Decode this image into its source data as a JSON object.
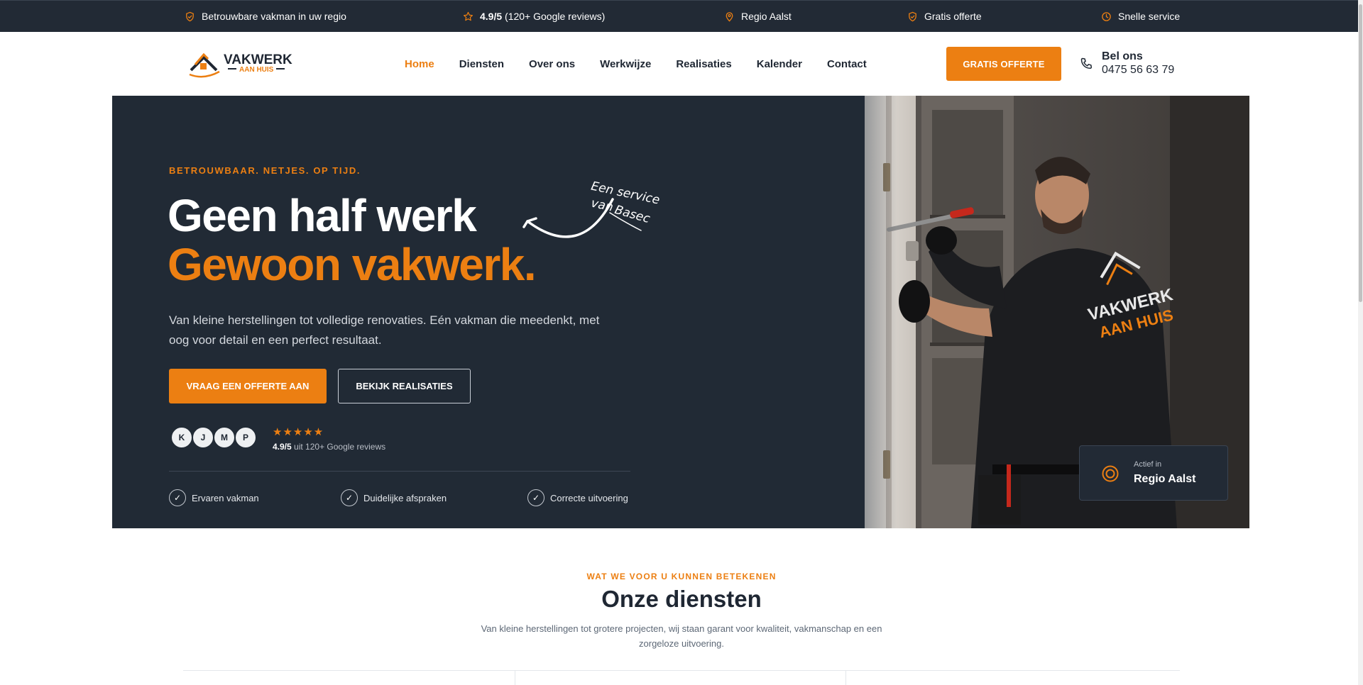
{
  "topbar": {
    "items": [
      {
        "icon": "shield-check-icon",
        "text": "Betrouwbare vakman in uw regio"
      },
      {
        "icon": "star-icon",
        "rating": "4.9/5",
        "text": "(120+ Google reviews)"
      },
      {
        "icon": "map-pin-icon",
        "text": "Regio Aalst"
      },
      {
        "icon": "shield-check-icon",
        "text": "Gratis offerte"
      },
      {
        "icon": "clock-icon",
        "text": "Snelle service"
      }
    ]
  },
  "header": {
    "logo": {
      "line1": "VAKWERK",
      "line2": "AAN HUIS"
    },
    "nav": [
      "Home",
      "Diensten",
      "Over ons",
      "Werkwijze",
      "Realisaties",
      "Kalender",
      "Contact"
    ],
    "active_nav": "Home",
    "cta": "GRATIS OFFERTE",
    "call_label": "Bel ons",
    "phone": "0475 56 63 79"
  },
  "hero": {
    "eyebrow": "BETROUWBAAR. NETJES. OP TIJD.",
    "title_line1": "Geen half werk",
    "title_line2": "Gewoon vakwerk.",
    "handwritten_line1": "Een service",
    "handwritten_line2": "van",
    "handwritten_brand": "Basec",
    "description": "Van kleine herstellingen tot volledige renovaties. Eén vakman die meedenkt, met oog voor detail en een perfect resultaat.",
    "primary_button": "VRAAG EEN OFFERTE AAN",
    "secondary_button": "BEKIJK REALISATIES",
    "avatars": [
      "K",
      "J",
      "M",
      "P"
    ],
    "stars": "★★★★★",
    "rating_value": "4.9/5",
    "rating_text": "uit 120+ Google reviews",
    "features": [
      "Ervaren vakman",
      "Duidelijke afspraken",
      "Correcte uitvoering"
    ],
    "badge_small": "Actief in",
    "badge_big": "Regio Aalst",
    "shirt_text_1": "VAKWERK",
    "shirt_text_2": "AAN HUIS"
  },
  "services": {
    "eyebrow": "WAT WE VOOR U KUNNEN BETEKENEN",
    "title": "Onze diensten",
    "description": "Van kleine herstellingen tot grotere projecten, wij staan garant voor kwaliteit, vakmanschap en een zorgeloze uitvoering."
  },
  "colors": {
    "accent": "#ec7f12",
    "dark": "#212a35",
    "topbar": "#222a35"
  }
}
